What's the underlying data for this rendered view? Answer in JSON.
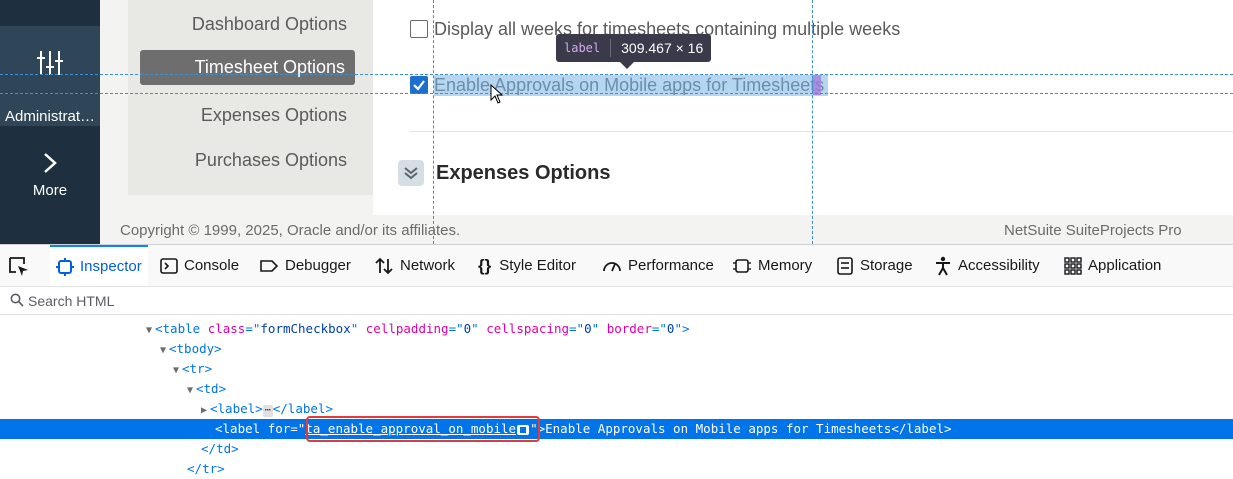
{
  "leftnav": {
    "admin_label": "Administrat…",
    "more_label": "More"
  },
  "submenu": {
    "items": [
      {
        "label": "Dashboard Options"
      },
      {
        "label": "Timesheet Options"
      },
      {
        "label": "Expenses Options"
      },
      {
        "label": "Purchases Options"
      }
    ],
    "active_index": 1
  },
  "options": {
    "display_weeks_label": "Display all weeks for timesheets containing multiple weeks",
    "display_weeks_checked": false,
    "enable_approvals_label": "Enable Approvals on Mobile apps for Timesheets",
    "enable_approvals_checked": true,
    "section_title": "Expenses Options"
  },
  "footer": {
    "copyright": "Copyright © 1999, 2025, Oracle and/or its affiliates.",
    "brand": "NetSuite SuiteProjects Pro"
  },
  "inspector_tooltip": {
    "tag": "label",
    "dims": "309.467 × 16"
  },
  "devtools": {
    "tabs": [
      {
        "label": "Inspector",
        "icon": "inspector-icon"
      },
      {
        "label": "Console",
        "icon": "console-icon"
      },
      {
        "label": "Debugger",
        "icon": "debugger-icon"
      },
      {
        "label": "Network",
        "icon": "network-icon"
      },
      {
        "label": "Style Editor",
        "icon": "style-editor-icon"
      },
      {
        "label": "Performance",
        "icon": "performance-icon"
      },
      {
        "label": "Memory",
        "icon": "memory-icon"
      },
      {
        "label": "Storage",
        "icon": "storage-icon"
      },
      {
        "label": "Accessibility",
        "icon": "accessibility-icon"
      },
      {
        "label": "Application",
        "icon": "application-icon"
      }
    ],
    "selected_tab": "Inspector",
    "search_placeholder": "Search HTML",
    "code": {
      "table_tag": "table",
      "table_class_attr": "class",
      "table_class_val": "formCheckbox",
      "cellpadding_attr": "cellpadding",
      "cellpadding_val": "0",
      "cellspacing_attr": "cellspacing",
      "cellspacing_val": "0",
      "border_attr": "border",
      "border_val": "0",
      "tbody_tag": "tbody",
      "tr_tag": "tr",
      "td_tag": "td",
      "label_tag": "label",
      "for_attr": "for",
      "for_val": "ta_enable_approval_on_mobile",
      "label_text": "Enable Approvals on Mobile apps for Timesheets",
      "ellipsis": "⋯"
    }
  }
}
